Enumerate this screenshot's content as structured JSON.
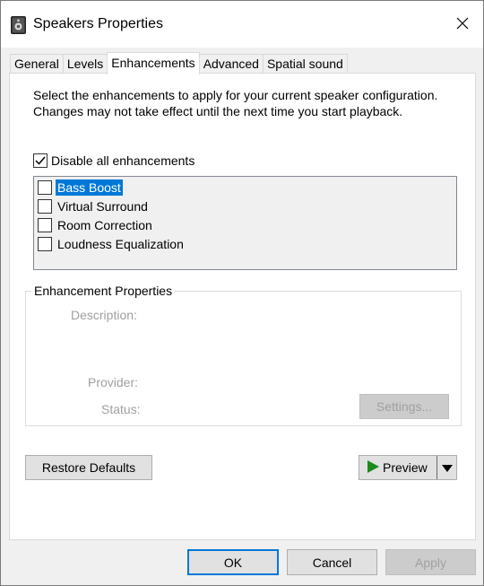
{
  "window": {
    "title": "Speakers Properties"
  },
  "tabs": [
    {
      "label": "General"
    },
    {
      "label": "Levels"
    },
    {
      "label": "Enhancements"
    },
    {
      "label": "Advanced"
    },
    {
      "label": "Spatial sound"
    }
  ],
  "active_tab": "Enhancements",
  "panel": {
    "intro": "Select the enhancements to apply for your current speaker configuration. Changes may not take effect until the next time you start playback.",
    "disable_all": {
      "label": "Disable all enhancements",
      "checked": true
    },
    "enhancements": [
      {
        "label": "Bass Boost",
        "checked": false,
        "selected": true
      },
      {
        "label": "Virtual Surround",
        "checked": false,
        "selected": false
      },
      {
        "label": "Room Correction",
        "checked": false,
        "selected": false
      },
      {
        "label": "Loudness Equalization",
        "checked": false,
        "selected": false
      }
    ],
    "properties": {
      "title": "Enhancement Properties",
      "description_label": "Description:",
      "provider_label": "Provider:",
      "status_label": "Status:",
      "settings_button": "Settings..."
    },
    "restore_defaults_button": "Restore Defaults",
    "preview_button": "Preview"
  },
  "footer": {
    "ok_button": "OK",
    "cancel_button": "Cancel",
    "apply_button": "Apply"
  },
  "colors": {
    "accent": "#0078d7",
    "play_green": "#1a8a1a"
  }
}
